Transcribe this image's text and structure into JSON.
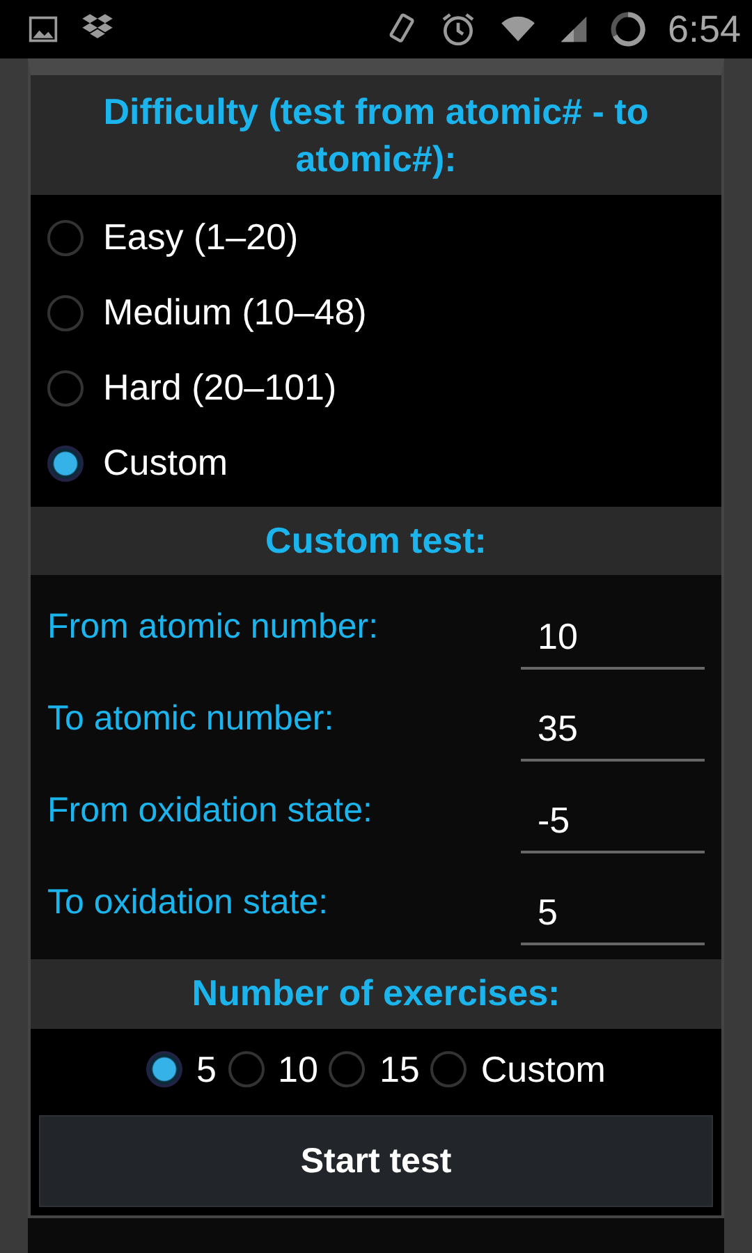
{
  "status_bar": {
    "time": "6:54"
  },
  "dialog": {
    "title": "Difficulty (test from atomic# - to atomic#):",
    "difficulty": [
      {
        "label": "Easy (1–20)",
        "selected": false
      },
      {
        "label": "Medium (10–48)",
        "selected": false
      },
      {
        "label": "Hard (20–101)",
        "selected": false
      },
      {
        "label": "Custom",
        "selected": true
      }
    ],
    "custom_title": "Custom test:",
    "fields": [
      {
        "label": "From atomic number:",
        "value": "10"
      },
      {
        "label": "To atomic number:",
        "value": "35"
      },
      {
        "label": "From oxidation state:",
        "value": "-5"
      },
      {
        "label": "To oxidation state:",
        "value": "5"
      }
    ],
    "exercises_title": "Number of exercises:",
    "exercises": [
      {
        "label": "5",
        "selected": true
      },
      {
        "label": "10",
        "selected": false
      },
      {
        "label": "15",
        "selected": false
      },
      {
        "label": "Custom",
        "selected": false
      }
    ],
    "button": "Start test"
  }
}
